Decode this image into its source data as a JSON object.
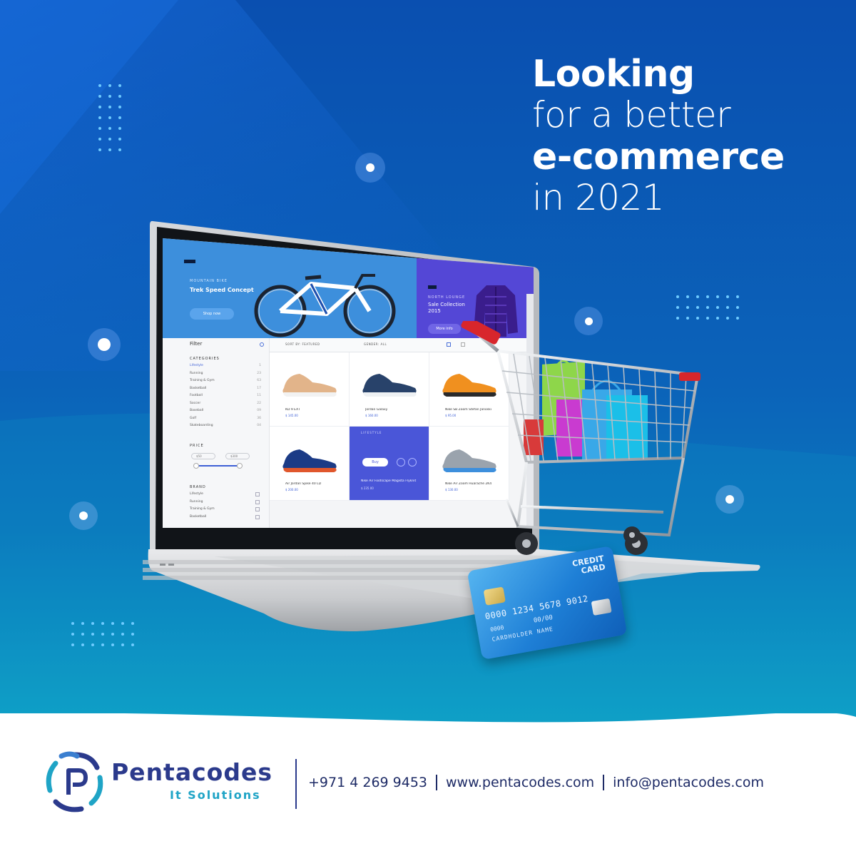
{
  "headline": {
    "line1": "Looking",
    "line2": "for a better",
    "line3": "e-commerce",
    "line4": "in 2021"
  },
  "colors": {
    "bg_top": "#0a56b4",
    "bg_mid": "#0c6fc0",
    "bg_bottom": "#16b6cc",
    "brand_navy": "#2b3a8c",
    "brand_cyan": "#1fa4c6",
    "text_dark": "#1e2b66"
  },
  "screen": {
    "hero_left": {
      "kicker": "MOUNTAIN BIKE",
      "title": "Trek Speed Concept",
      "button": "Shop now"
    },
    "hero_right": {
      "kicker": "NORTH LOUNGE",
      "title": "Sale Collection 2015",
      "button": "More info"
    },
    "filter_title": "Filter",
    "categories_title": "CATEGORIES",
    "categories": [
      {
        "label": "Lifestyle",
        "count": "1"
      },
      {
        "label": "Running",
        "count": "23"
      },
      {
        "label": "Training & Gym",
        "count": "63"
      },
      {
        "label": "Basketball",
        "count": "17"
      },
      {
        "label": "Football",
        "count": "11"
      },
      {
        "label": "Soccer",
        "count": "22"
      },
      {
        "label": "Baseball",
        "count": "09"
      },
      {
        "label": "Golf",
        "count": "36"
      },
      {
        "label": "Skateboarding",
        "count": "04"
      }
    ],
    "price_title": "PRICE",
    "price_min": "$50",
    "price_max": "$300",
    "brand_title": "BRAND",
    "brands": [
      "Lifestyle",
      "Running",
      "Training & Gym",
      "Basketball"
    ],
    "sort_label": "SORT BY: FEATURED",
    "gender_label": "GENDER: ALL",
    "products": [
      {
        "name": "KD 9 EXT",
        "price": "$ 145.00"
      },
      {
        "name": "Jordan Galaxy",
        "price": "$ 160.00"
      },
      {
        "name": "Nike SB Zoom Stefan Janoski",
        "price": "$ 95.00"
      },
      {
        "name": "Air Jordan Spike 40 LD",
        "price": "$ 200.00"
      },
      {
        "name": "Nike Air Footscape Magista Flyknit",
        "price": "$ 235.00",
        "kicker": "LIFESTYLE",
        "button": "Buy"
      },
      {
        "name": "Nike Air Zoom Huarache 2K4",
        "price": "$ 130.00"
      }
    ]
  },
  "card": {
    "title": "CREDIT CARD",
    "number": "0000 1234 5678 9012",
    "bank": "0000",
    "valid": "00/00",
    "holder": "CARDHOLDER NAME"
  },
  "footer": {
    "brand_part1": "Penta",
    "brand_part2": "codes",
    "tagline": "It Solutions",
    "phone": "+971 4 269 9453",
    "website": "www.pentacodes.com",
    "email": "info@pentacodes.com"
  },
  "icons": {
    "logo": "pentacodes-logo-icon",
    "cart": "shopping-cart-icon",
    "card": "credit-card-icon"
  }
}
